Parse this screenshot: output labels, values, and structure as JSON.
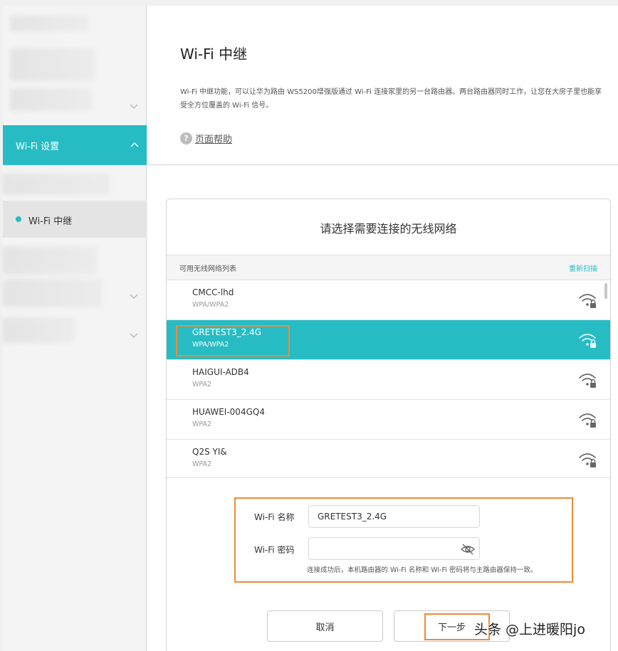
{
  "sidebar": {
    "active_section": "Wi-Fi 设置",
    "active_item": "Wi-Fi 中继"
  },
  "header": {
    "title": "Wi-Fi 中继",
    "description": "Wi-Fi 中继功能，可以让华为路由 WS5200增强版通过 Wi-Fi 连接家里的另一台路由器。两台路由器同时工作，让您在大房子里也能享受全方位覆盖的 Wi-Fi 信号。",
    "help_label": "页面帮助"
  },
  "panel": {
    "title": "请选择需要连接的无线网络",
    "list_header": "可用无线网络列表",
    "rescan_label": "重新扫描",
    "networks": [
      {
        "name": "CMCC-lhd",
        "security": "WPA/WPA2"
      },
      {
        "name": "GRETEST3_2.4G",
        "security": "WPA/WPA2"
      },
      {
        "name": "HAIGUI-ADB4",
        "security": "WPA2"
      },
      {
        "name": "HUAWEI-004GQ4",
        "security": "WPA2"
      },
      {
        "name": "Q2S YI&",
        "security": "WPA2"
      }
    ],
    "selected_index": 1
  },
  "form": {
    "ssid_label": "Wi-Fi 名称",
    "ssid_value": "GRETEST3_2.4G",
    "password_label": "Wi-Fi 密码",
    "password_value": "",
    "hint": "连接成功后，本机路由器的 Wi-Fi 名称和 Wi-Fi 密码将与主路由器保持一致。"
  },
  "buttons": {
    "cancel": "取消",
    "next": "下一步"
  },
  "watermark": "头条 @上进暖阳jo",
  "colors": {
    "accent": "#27bcc4",
    "highlight": "#ee8a3a"
  },
  "icons": [
    "chevron-down-icon",
    "chevron-up-icon",
    "help-icon",
    "wifi-lock-icon",
    "eye-hidden-icon"
  ]
}
